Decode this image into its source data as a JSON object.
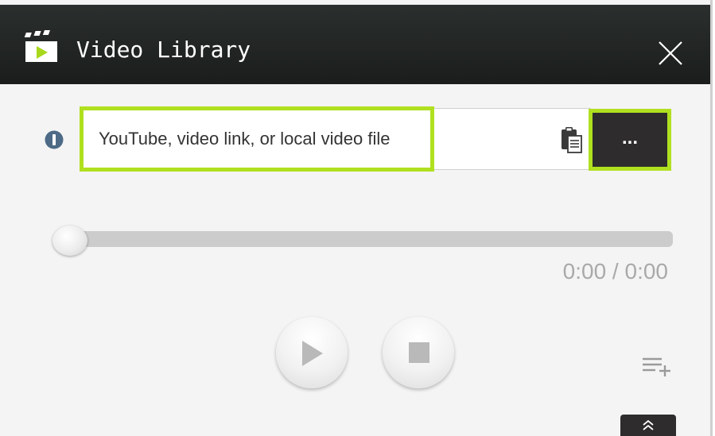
{
  "window": {
    "title": "Video Library"
  },
  "icons": {
    "app": "clapperboard-play-icon",
    "close": "close-icon",
    "info": "info-icon",
    "clipboard": "clipboard-paste-icon",
    "play": "play-icon",
    "stop": "stop-icon",
    "playlist_add": "playlist-add-icon",
    "expand": "double-chevron-up-icon"
  },
  "source": {
    "placeholder": "YouTube, video link, or local video file",
    "value": "",
    "browse_label": "..."
  },
  "player": {
    "progress": 0,
    "time_readout": "0:00 / 0:00"
  },
  "colors": {
    "titlebar": "#1f2322",
    "highlight": "#b0e01f",
    "button_dark": "#2e2c2d",
    "app_icon_accent": "#a8d81c",
    "muted_text": "#a9a9a9"
  }
}
